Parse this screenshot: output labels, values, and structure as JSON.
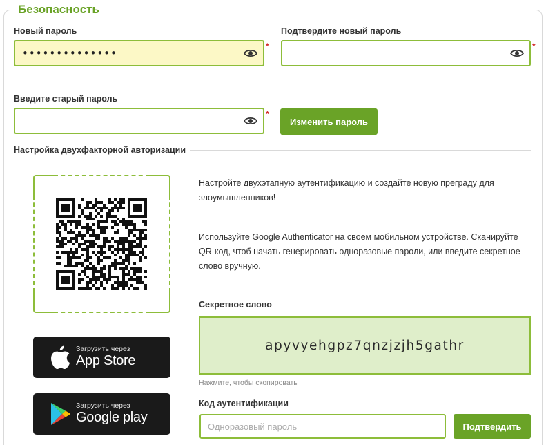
{
  "section": {
    "title": "Безопасность"
  },
  "new_password": {
    "label": "Новый пароль",
    "value": "••••••••••••••",
    "required_mark": "*"
  },
  "confirm_password": {
    "label": "Подтвердите новый пароль",
    "value": "",
    "required_mark": "*"
  },
  "old_password": {
    "label": "Введите старый пароль",
    "value": "",
    "required_mark": "*"
  },
  "change_password_button": "Изменить пароль",
  "two_factor": {
    "title": "Настройка двухфакторной авторизации",
    "intro": "Настройте двухэтапную аутентификацию и создайте новую преграду для злоумышленников!",
    "instructions": "Используйте Google Authenticator на своем мобильном устройстве. Сканируйте QR-код, чтоб начать генерировать одноразовые пароли, или введите секретное слово вручную.",
    "secret_label": "Секретное слово",
    "secret_value": "apyvyehgpz7qnzjzjh5gathr",
    "copy_hint": "Нажмите, чтобы скопировать",
    "code_label": "Код аутентификации",
    "code_placeholder": "Одноразовый пароль",
    "confirm_button": "Подтвердить"
  },
  "stores": {
    "app_store": {
      "small": "Загрузить через",
      "big": "App Store",
      "icon": "apple-icon"
    },
    "google_play": {
      "small": "Загрузить через",
      "big": "Google play",
      "icon": "google-play-icon"
    }
  },
  "icons": {
    "visibility": "eye-icon",
    "qr": "qr-code"
  },
  "colors": {
    "accent": "#6aa327",
    "border": "#8dbd3a",
    "secret_bg": "#dfeeca",
    "autofill_bg": "#fcf8c6",
    "required": "#d32b2b"
  }
}
